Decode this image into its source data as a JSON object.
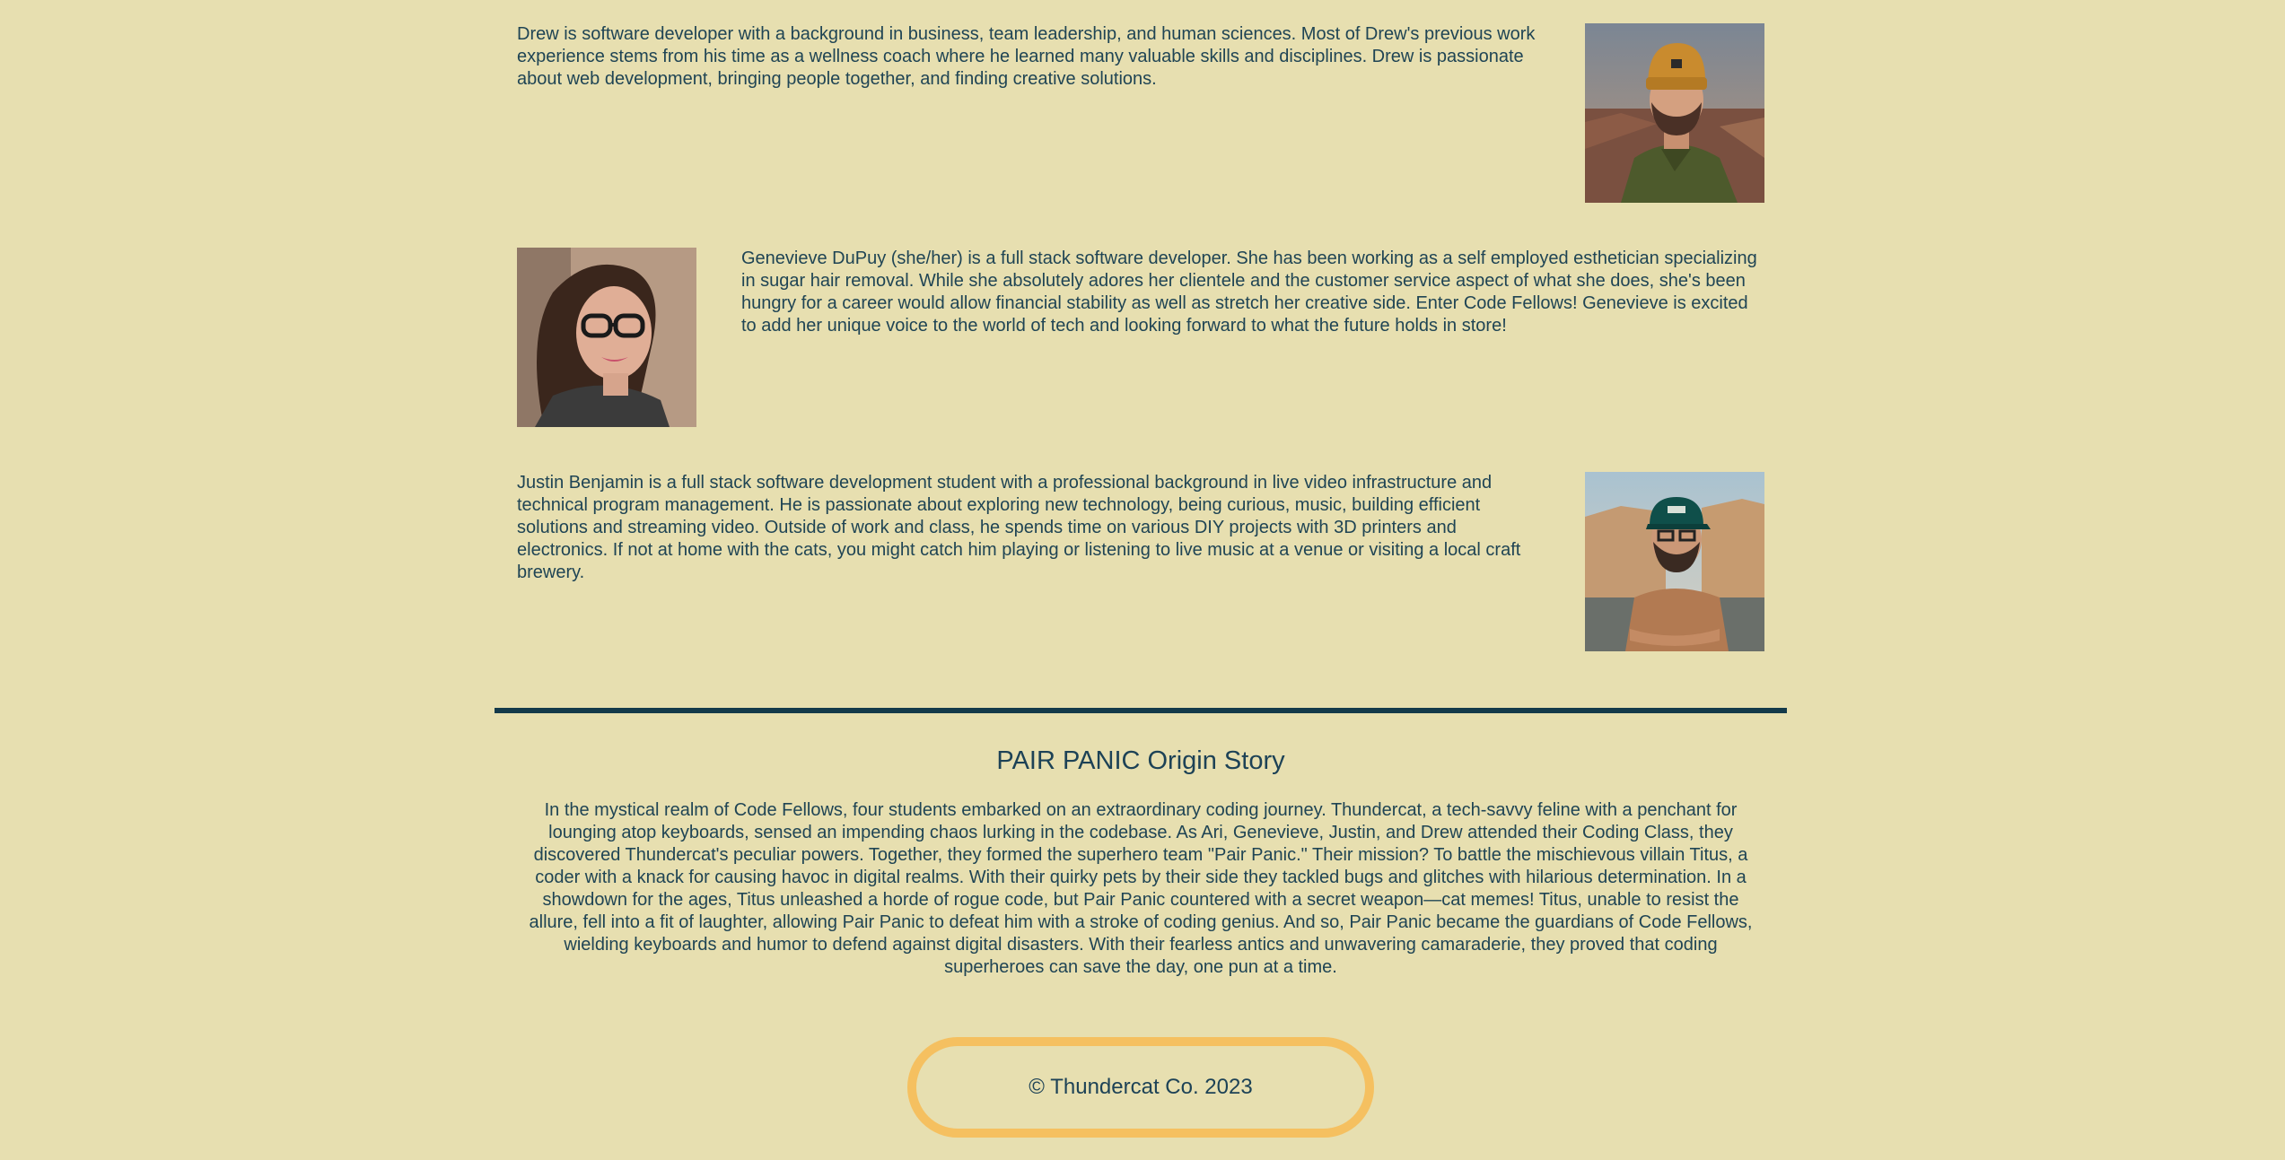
{
  "bios": [
    {
      "name": "Drew",
      "text": "Drew is software developer with a background in business, team leadership, and human sciences. Most of Drew's previous work experience stems from his time as a wellness coach where he learned many valuable skills and disciplines. Drew is passionate about web development, bringing people together, and finding creative solutions."
    },
    {
      "name": "Genevieve",
      "text": "Genevieve DuPuy (she/her) is a full stack software developer. She has been working as a self employed esthetician specializing in sugar hair removal. While she absolutely adores her clientele and the customer service aspect of what she does, she's been hungry for a career would allow financial stability as well as stretch her creative side. Enter Code Fellows! Genevieve is excited to add her unique voice to the world of tech and looking forward to what the future holds in store!"
    },
    {
      "name": "Justin",
      "text": "Justin Benjamin is a full stack software development student with a professional background in live video infrastructure and technical program management. He is passionate about exploring new technology, being curious, music, building efficient solutions and streaming video. Outside of work and class, he spends time on various DIY projects with 3D printers and electronics. If not at home with the cats, you might catch him playing or listening to live music at a venue or visiting a local craft brewery."
    }
  ],
  "origin": {
    "title": "PAIR PANIC Origin Story",
    "text": "In the mystical realm of Code Fellows, four students embarked on an extraordinary coding journey. Thundercat, a tech-savvy feline with a penchant for lounging atop keyboards, sensed an impending chaos lurking in the codebase. As Ari, Genevieve, Justin, and Drew attended their Coding Class, they discovered Thundercat's peculiar powers. Together, they formed the superhero team \"Pair Panic.\" Their mission? To battle the mischievous villain Titus, a coder with a knack for causing havoc in digital realms. With their quirky pets by their side they tackled bugs and glitches with hilarious determination. In a showdown for the ages, Titus unleashed a horde of rogue code, but Pair Panic countered with a secret weapon—cat memes! Titus, unable to resist the allure, fell into a fit of laughter, allowing Pair Panic to defeat him with a stroke of coding genius. And so, Pair Panic became the guardians of Code Fellows, wielding keyboards and humor to defend against digital disasters. With their fearless antics and unwavering camaraderie, they proved that coding superheroes can save the day, one pun at a time."
  },
  "footer": {
    "text": "© Thundercat Co. 2023"
  },
  "colors": {
    "background": "#e7dfb0",
    "text": "#1f4454",
    "divider": "#143a4a",
    "footer_border": "#f5c060"
  }
}
